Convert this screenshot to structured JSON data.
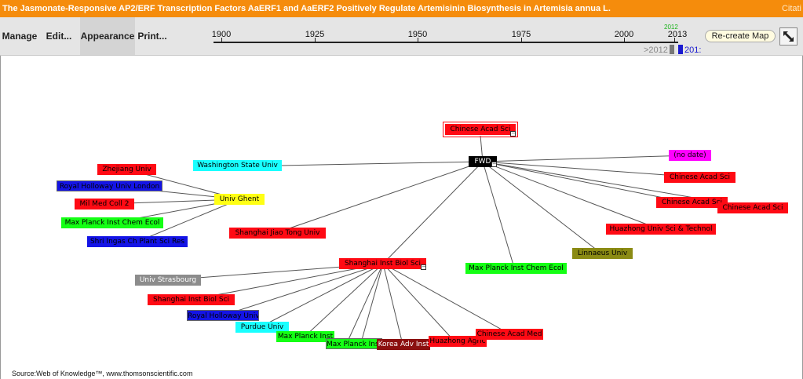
{
  "header": {
    "title": "The Jasmonate-Responsive AP2/ERF Transcription Factors AaERF1 and AaERF2 Positively Regulate Artemisinin Biosynthesis in Artemisia annua L.",
    "citation_label": "Citati"
  },
  "menu": [
    {
      "id": "manage",
      "label": "Manage"
    },
    {
      "id": "edit",
      "label": "Edit..."
    },
    {
      "id": "appearance",
      "label": "Appearance"
    },
    {
      "id": "print",
      "label": "Print..."
    }
  ],
  "timeline": {
    "years": [
      "1900",
      "1925",
      "1950",
      "1975",
      "2000",
      "2013"
    ],
    "upper_value": "2012",
    "range_start": ">2012",
    "range_end": "201:"
  },
  "recreate_label": "Re-create Map",
  "colors": {
    "red": "#ff0a14",
    "blue": "#1414e6",
    "cyan": "#19ffff",
    "yellow": "#ffff14",
    "green": "#14ff14",
    "magenta": "#ff00ff",
    "olive": "#8b8b14",
    "gray": "#8c8c8c",
    "maroon": "#8b0f0f",
    "black": "#000000"
  },
  "nodes": [
    {
      "id": "n1",
      "label": "Chinese Acad Sci",
      "color": "red",
      "collapsible": true
    },
    {
      "id": "n2",
      "label": "FWD",
      "color": "black",
      "collapsible": true
    },
    {
      "id": "n3",
      "label": "(no date)",
      "color": "magenta"
    },
    {
      "id": "n4",
      "label": "Chinese Acad Sci",
      "color": "red"
    },
    {
      "id": "n5",
      "label": "Chinese Acad Sci",
      "color": "red",
      "collapsible": true
    },
    {
      "id": "n6",
      "label": "Chinese Acad Sci",
      "color": "red"
    },
    {
      "id": "n7",
      "label": "Huazhong Univ Sci & Technol",
      "color": "red"
    },
    {
      "id": "n8",
      "label": "Linnaeus Univ",
      "color": "olive"
    },
    {
      "id": "n9",
      "label": "Max Planck Inst Chem Ecol",
      "color": "green"
    },
    {
      "id": "n10",
      "label": "Washington State Univ",
      "color": "cyan"
    },
    {
      "id": "n11",
      "label": "Univ Ghent",
      "color": "yellow"
    },
    {
      "id": "n12",
      "label": "Zhejiang Univ",
      "color": "red"
    },
    {
      "id": "n13",
      "label": "Royal Holloway Univ London",
      "color": "blue"
    },
    {
      "id": "n14",
      "label": "Mil Med Coll 2",
      "color": "red"
    },
    {
      "id": "n15",
      "label": "Max Planck Inst Chem Ecol",
      "color": "green"
    },
    {
      "id": "n16",
      "label": "Shri Ingas Ch Plant Sci Res",
      "color": "blue"
    },
    {
      "id": "n17",
      "label": "Shanghai Jiao Tong Univ",
      "color": "red"
    },
    {
      "id": "n18",
      "label": "Shanghai Inst Biol Sci",
      "color": "red",
      "collapsible": true
    },
    {
      "id": "n19",
      "label": "Univ Strasbourg",
      "color": "gray"
    },
    {
      "id": "n20",
      "label": "Shanghai Inst Biol Sci",
      "color": "red"
    },
    {
      "id": "n21",
      "label": "Royal Holloway Univ",
      "color": "blue"
    },
    {
      "id": "n22",
      "label": "Purdue Univ",
      "color": "cyan"
    },
    {
      "id": "n23",
      "label": "Max Planck Inst",
      "color": "green"
    },
    {
      "id": "n24",
      "label": "Max Planck Inst",
      "color": "green"
    },
    {
      "id": "n25",
      "label": "Korea Adv Inst",
      "color": "maroon"
    },
    {
      "id": "n26",
      "label": "Huazhong Agric",
      "color": "red"
    },
    {
      "id": "n27",
      "label": "Chinese Acad Med",
      "color": "red"
    }
  ],
  "source": "Source:Web of Knowledge™, www.thomsonscientific.com"
}
